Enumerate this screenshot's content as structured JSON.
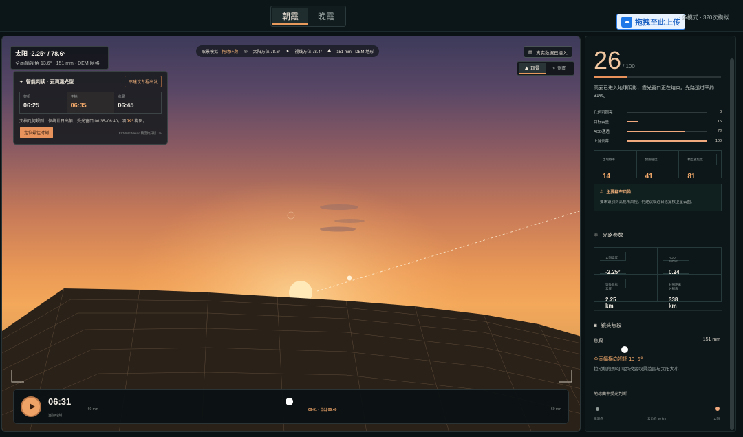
{
  "topbar": {
    "tabs": [
      {
        "label": "朝霞"
      },
      {
        "label": "晚霞"
      }
    ],
    "upload_label": "拖拽至此上传",
    "right_text": "· 多模式 · 320次模拟"
  },
  "viewport": {
    "hud": {
      "mode": "取景模拟",
      "drag": "拖动环顾",
      "sun_azimuth": "太阳方位 78.6°",
      "view_azimuth": "视线方位 78.4°",
      "lens": "151 mm · DEM 地形"
    },
    "sun_info": {
      "title": "太阳 -2.25° / 78.6°",
      "sub": "全画幅视角 13.6° · 151 mm · DEM 网格"
    },
    "ai_card": {
      "title": "智能判读 · 云洞漏光型",
      "warn": "不建议专程出发",
      "cols": [
        {
          "label": "架机",
          "value": "06:25"
        },
        {
          "label": "主拍",
          "value": "06:35"
        },
        {
          "label": "收尾",
          "value": "06:45"
        }
      ],
      "note_prefix": "文档几何规则：仅统计日出前；受光窗口 06:35–06:40。明 ",
      "note_highlight": "79°",
      "note_suffix": " 构图。",
      "button": "定位最佳时刻",
      "source": "ECMWF/Meteo 精度约升级 1%"
    },
    "real_data": "真实数据已接入",
    "toggle": [
      {
        "label": "取景"
      },
      {
        "label": "剖面"
      }
    ],
    "timeline": {
      "time": "06:31",
      "sub": "当前时刻",
      "left": "-60 min",
      "center": "09-01 · 日出 06:40",
      "right": "+60 min",
      "progress": 0.5
    }
  },
  "panel": {
    "score": "26",
    "score_den": "/ 100",
    "score_value": 26,
    "desc": "高云已进入地球阴影，霞光窗口正在结束。光路透过率约 31%。",
    "metrics": [
      {
        "name": "几何可照亮",
        "value": "0",
        "num": 0
      },
      {
        "name": "目标云量",
        "value": "15",
        "num": 15
      },
      {
        "name": "AOD通透",
        "value": "72",
        "num": 72
      },
      {
        "name": "上游云幕",
        "value": "100",
        "num": 100
      }
    ],
    "boxes": [
      {
        "label": "出现概率",
        "value": "14"
      },
      {
        "label": "预期强度",
        "value": "41"
      },
      {
        "label": "模型置信度",
        "value": "81"
      }
    ],
    "risk": {
      "title": "主要翻车风险",
      "desc": "要求识别到高视角风险。仍建议临近日落复核卫星云图。"
    },
    "optics_title": "光路参数",
    "optics": [
      {
        "label": "太阳高度",
        "value": "-2.25°"
      },
      {
        "label": "AOD 550nm",
        "value": "0.24"
      },
      {
        "label": "等效日标云底",
        "value": "2.25 km"
      },
      {
        "label": "对照距离入射表",
        "value": "338 km"
      }
    ],
    "lens_title": "镜头焦段",
    "focal_label": "焦段",
    "focal_value": "151 mm",
    "fov_label": "全画幅横向视场",
    "fov_value": "13.6°",
    "fov_desc": "拉动焦段即可同步改变取景范围与太阳大小",
    "earth_title": "地球曲率受光判断",
    "earth_labels": [
      "观测点",
      "云边界 80 km",
      "太阳"
    ]
  }
}
